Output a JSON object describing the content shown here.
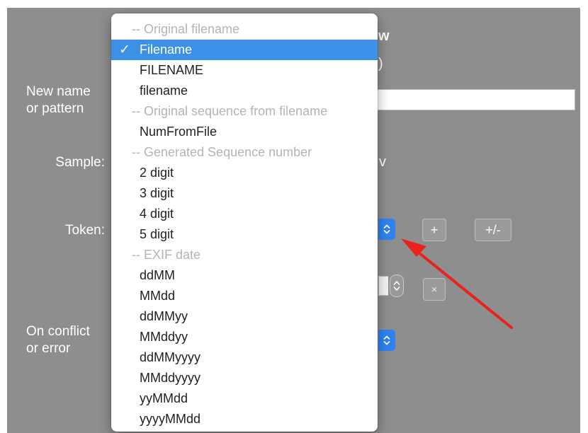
{
  "dialog": {
    "title_peek": "w",
    "subtitle_peek": ")",
    "sample_peek": "v",
    "new_name_label": "New name\nor pattern",
    "sample_label": "Sample:",
    "token_label": "Token:",
    "conflict_label": "On conflict\nor error",
    "add_button_label": "+",
    "plusminus_button_label": "+/-",
    "remove_button_label": "×"
  },
  "token_menu": {
    "checkmark": "✓",
    "selected_index": 1,
    "items": [
      {
        "label": "-- Original filename",
        "header": true
      },
      {
        "label": "Filename",
        "header": false
      },
      {
        "label": "FILENAME",
        "header": false
      },
      {
        "label": "filename",
        "header": false
      },
      {
        "label": "-- Original sequence from filename",
        "header": true
      },
      {
        "label": "NumFromFile",
        "header": false
      },
      {
        "label": "-- Generated Sequence number",
        "header": true
      },
      {
        "label": "2 digit",
        "header": false
      },
      {
        "label": "3 digit",
        "header": false
      },
      {
        "label": "4 digit",
        "header": false
      },
      {
        "label": "5 digit",
        "header": false
      },
      {
        "label": "-- EXIF date",
        "header": true
      },
      {
        "label": "ddMM",
        "header": false
      },
      {
        "label": "MMdd",
        "header": false
      },
      {
        "label": "ddMMyy",
        "header": false
      },
      {
        "label": "MMddyy",
        "header": false
      },
      {
        "label": "ddMMyyyy",
        "header": false
      },
      {
        "label": "MMddyyyy",
        "header": false
      },
      {
        "label": "yyMMdd",
        "header": false
      },
      {
        "label": "yyyyMMdd",
        "header": false
      }
    ]
  },
  "colors": {
    "window_bg": "#8e8e8e",
    "accent": "#2e83f2",
    "selection": "#3c90e6",
    "arrow": "#e8221c"
  }
}
